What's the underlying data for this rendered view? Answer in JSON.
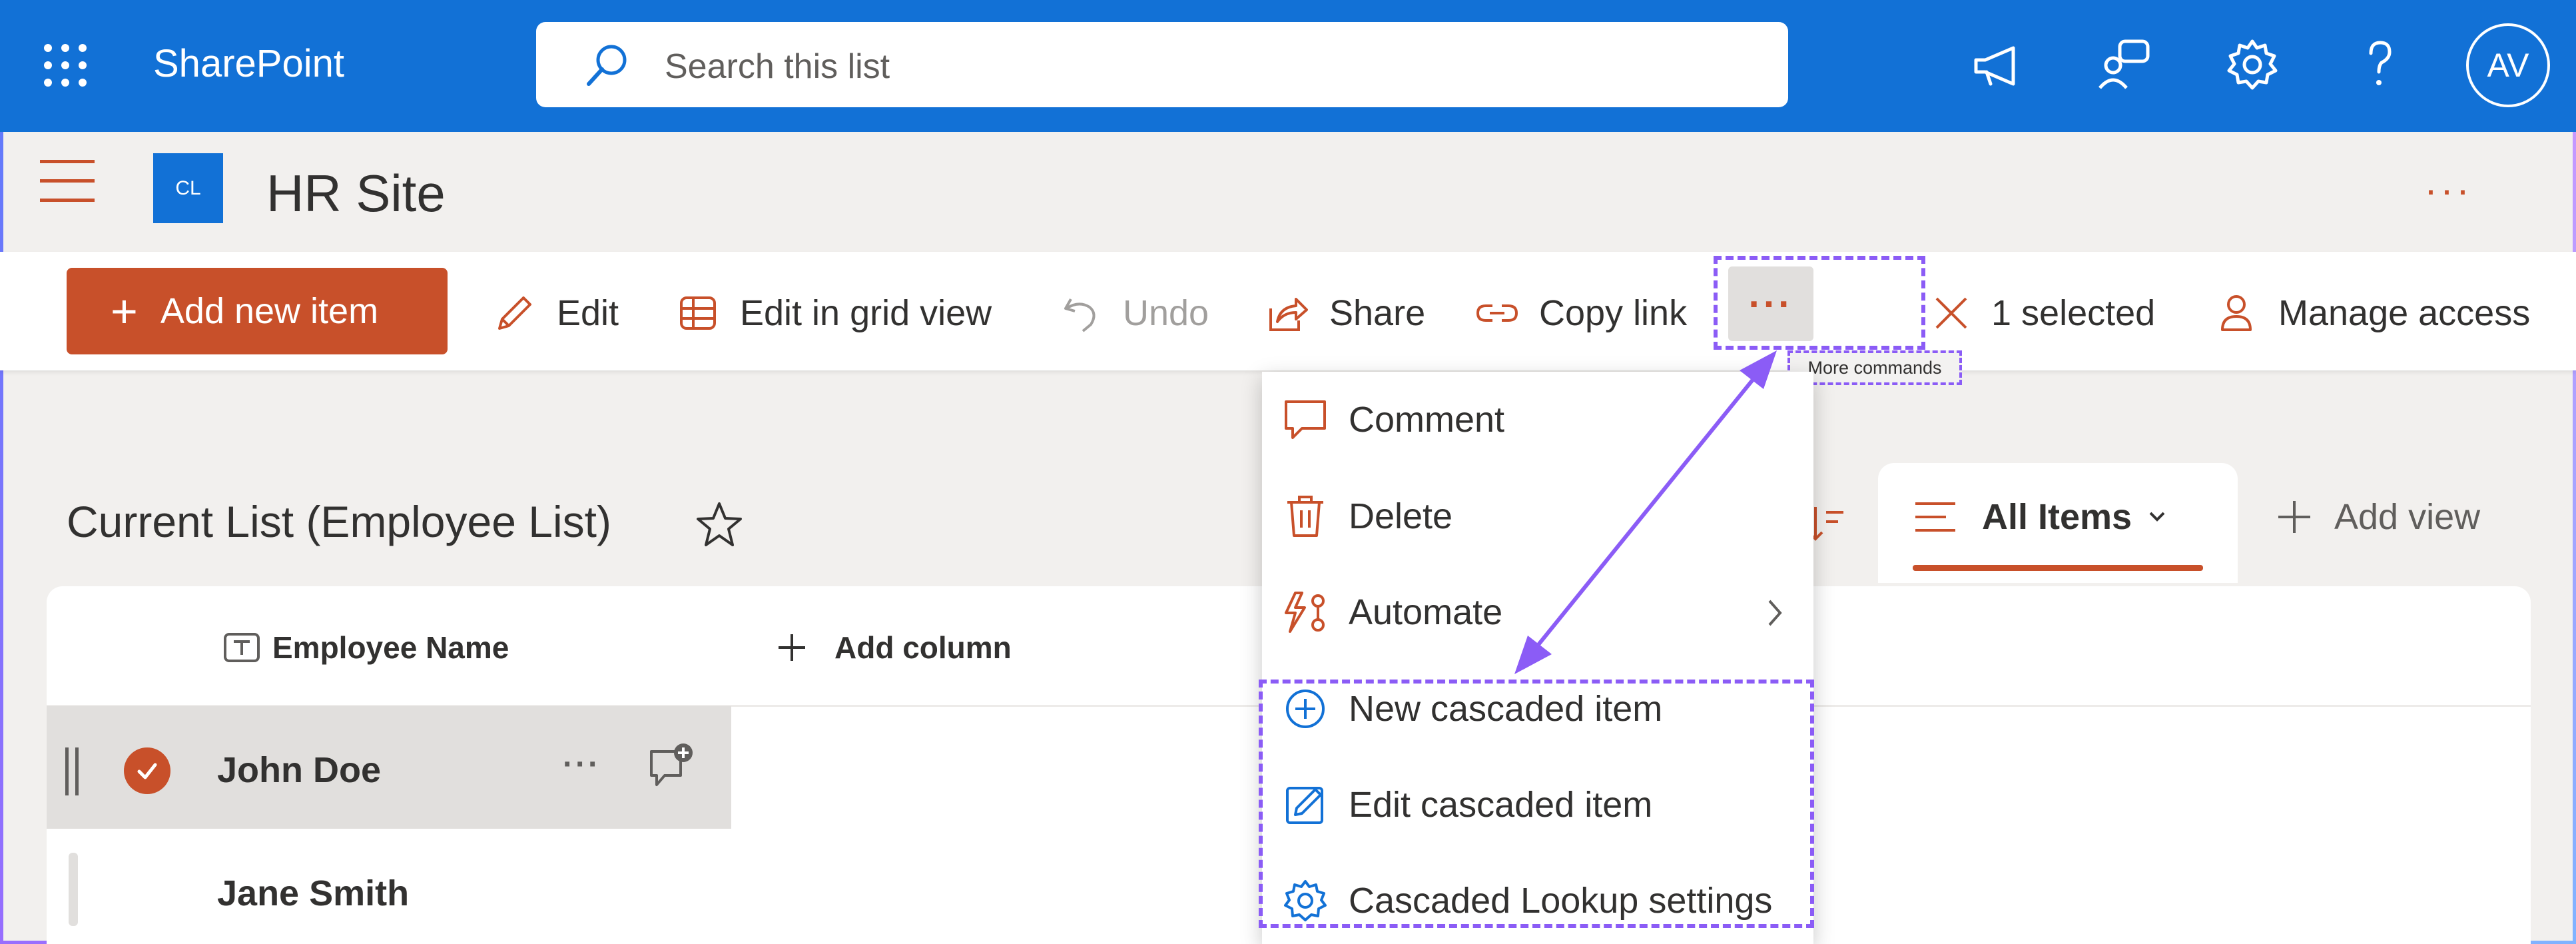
{
  "suite_bar": {
    "app_name": "SharePoint",
    "search_placeholder": "Search this list",
    "avatar_initials": "AV",
    "icons": [
      "waffle-icon",
      "megaphone-icon",
      "feedback-icon",
      "gear-icon",
      "help-icon"
    ],
    "background_color": "#1271d6"
  },
  "site": {
    "logo_text": "CL",
    "title": "HR Site",
    "more_label": "···"
  },
  "command_bar": {
    "add_new_item": "Add new item",
    "edit": "Edit",
    "edit_grid": "Edit in grid view",
    "undo": "Undo",
    "share": "Share",
    "copy_link": "Copy link",
    "more": "···",
    "more_tooltip": "More commands",
    "selected": "1 selected",
    "manage_access": "Manage access",
    "accent_color": "#c8502a"
  },
  "list": {
    "title": "Current List (Employee List)",
    "view_name": "All Items",
    "add_view": "Add view",
    "columns": [
      "Employee Name"
    ],
    "add_column": "Add column",
    "rows": [
      {
        "name": "John Doe",
        "selected": true,
        "more": "···"
      },
      {
        "name": "Jane Smith",
        "selected": false
      }
    ]
  },
  "menu": {
    "items": [
      {
        "label": "Comment",
        "icon": "comment-icon"
      },
      {
        "label": "Delete",
        "icon": "trash-icon"
      },
      {
        "label": "Automate",
        "icon": "automate-icon",
        "submenu": true
      },
      {
        "label": "New cascaded item",
        "icon": "plus-circle-icon"
      },
      {
        "label": "Edit cascaded item",
        "icon": "edit-square-icon"
      },
      {
        "label": "Cascaded Lookup settings",
        "icon": "gear-icon"
      }
    ],
    "highlight_color": "#8b5cf6"
  }
}
